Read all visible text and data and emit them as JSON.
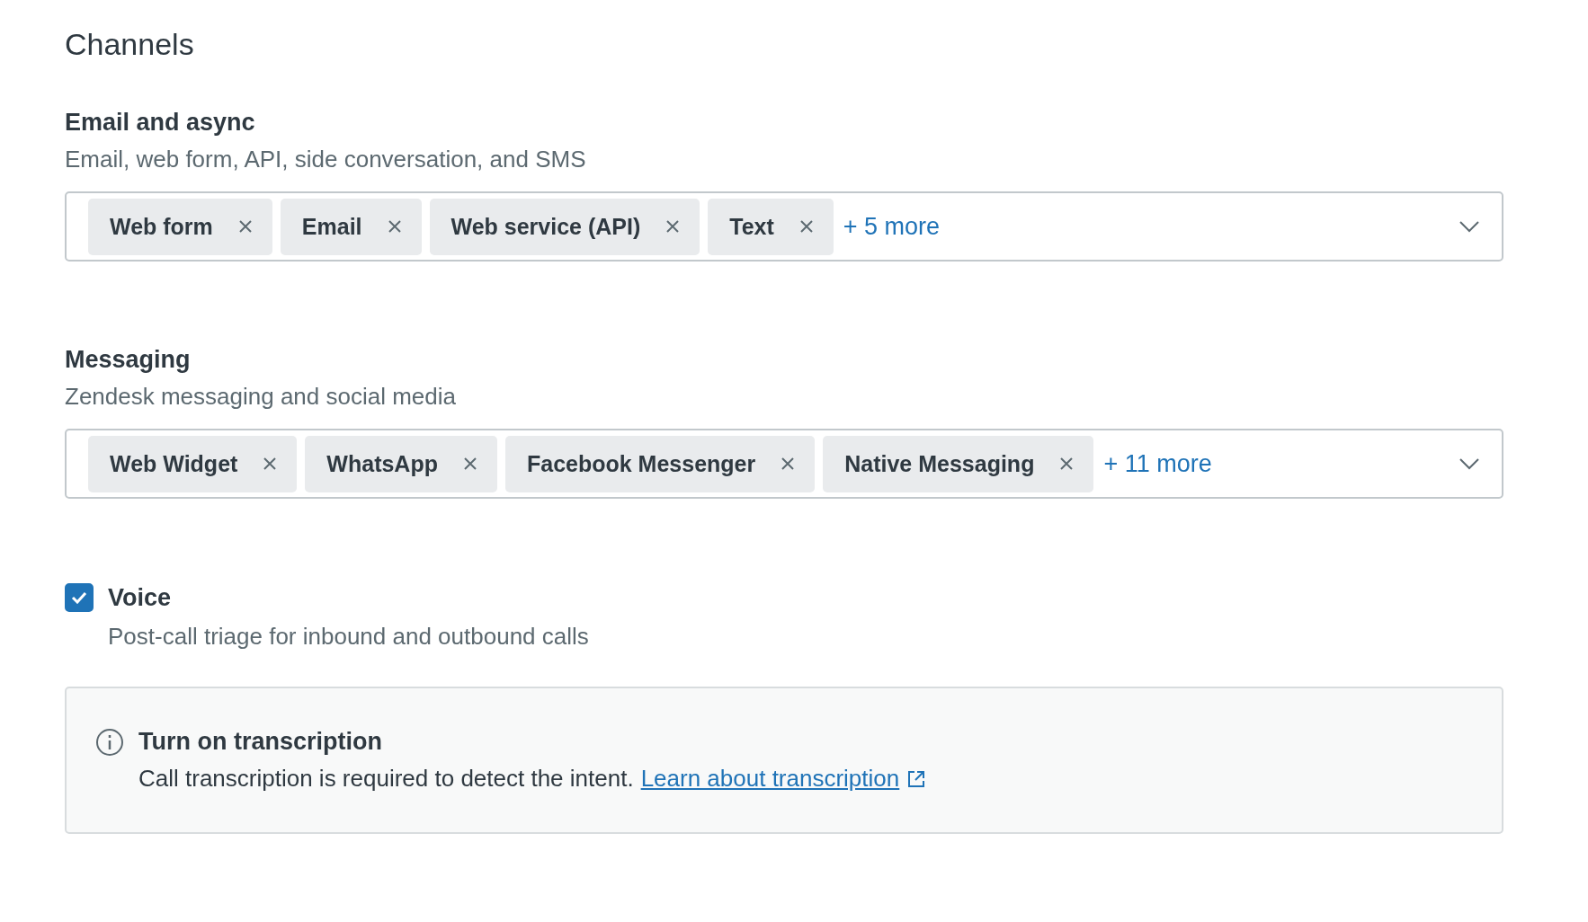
{
  "title": "Channels",
  "sections": [
    {
      "heading": "Email and async",
      "description": "Email, web form, API, side conversation, and SMS",
      "tags": [
        "Web form",
        "Email",
        "Web service (API)",
        "Text"
      ],
      "more": "+ 5 more"
    },
    {
      "heading": "Messaging",
      "description": "Zendesk messaging and social media",
      "tags": [
        "Web Widget",
        "WhatsApp",
        "Facebook Messenger",
        "Native Messaging"
      ],
      "more": "+ 11 more"
    }
  ],
  "voice": {
    "label": "Voice",
    "checked": true,
    "description": "Post-call triage for inbound and outbound calls"
  },
  "notice": {
    "title": "Turn on transcription",
    "text": "Call transcription is required to detect the intent.",
    "link": "Learn about transcription"
  }
}
